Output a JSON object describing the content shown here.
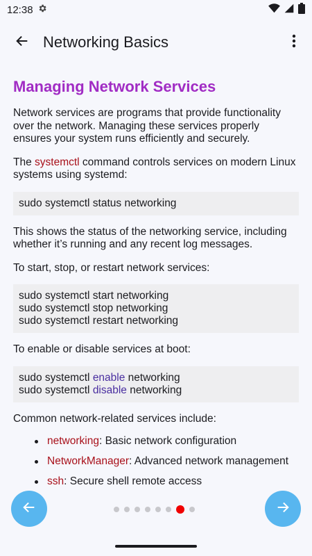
{
  "status_bar": {
    "time": "12:38"
  },
  "app_bar": {
    "title": "Networking Basics"
  },
  "content": {
    "heading": "Managing Network Services",
    "intro": "Network services are programs that provide functionality over the network. Managing these services properly ensures your system runs efficiently and securely.",
    "systemctl_para": {
      "pre": "The ",
      "keyword": "systemctl",
      "post": " command controls services on modern Linux systems using systemd:"
    },
    "code_status": "sudo systemctl status networking",
    "status_explain": "This shows the status of the networking service, including whether it’s running and any recent log messages.",
    "start_stop_para": "To start, stop, or restart network services:",
    "code_start_stop": [
      "sudo systemctl start networking",
      "sudo systemctl stop networking",
      "sudo systemctl restart networking"
    ],
    "enable_para": "To enable or disable services at boot:",
    "code_enable": [
      {
        "pre": "sudo systemctl ",
        "keyword": "enable",
        "post": " networking"
      },
      {
        "pre": "sudo systemctl ",
        "keyword": "disable",
        "post": " networking"
      }
    ],
    "services_para": "Common network-related services include:",
    "services": [
      {
        "name": "networking",
        "desc": ": Basic network configuration"
      },
      {
        "name": "NetworkManager",
        "desc": ": Advanced network management"
      },
      {
        "name": "ssh",
        "desc": ": Secure shell remote access"
      }
    ]
  },
  "pager": {
    "total": 8,
    "active_index": 6
  },
  "colors": {
    "heading": "#a12cc4",
    "keyword_red": "#a8101a",
    "keyword_purple": "#4a2fa0",
    "fab": "#58b6ef",
    "active_dot": "#f00000"
  },
  "icons": {
    "back": "arrow-left-icon",
    "more": "more-vert-icon",
    "prev": "arrow-left-icon",
    "next": "arrow-right-icon"
  }
}
